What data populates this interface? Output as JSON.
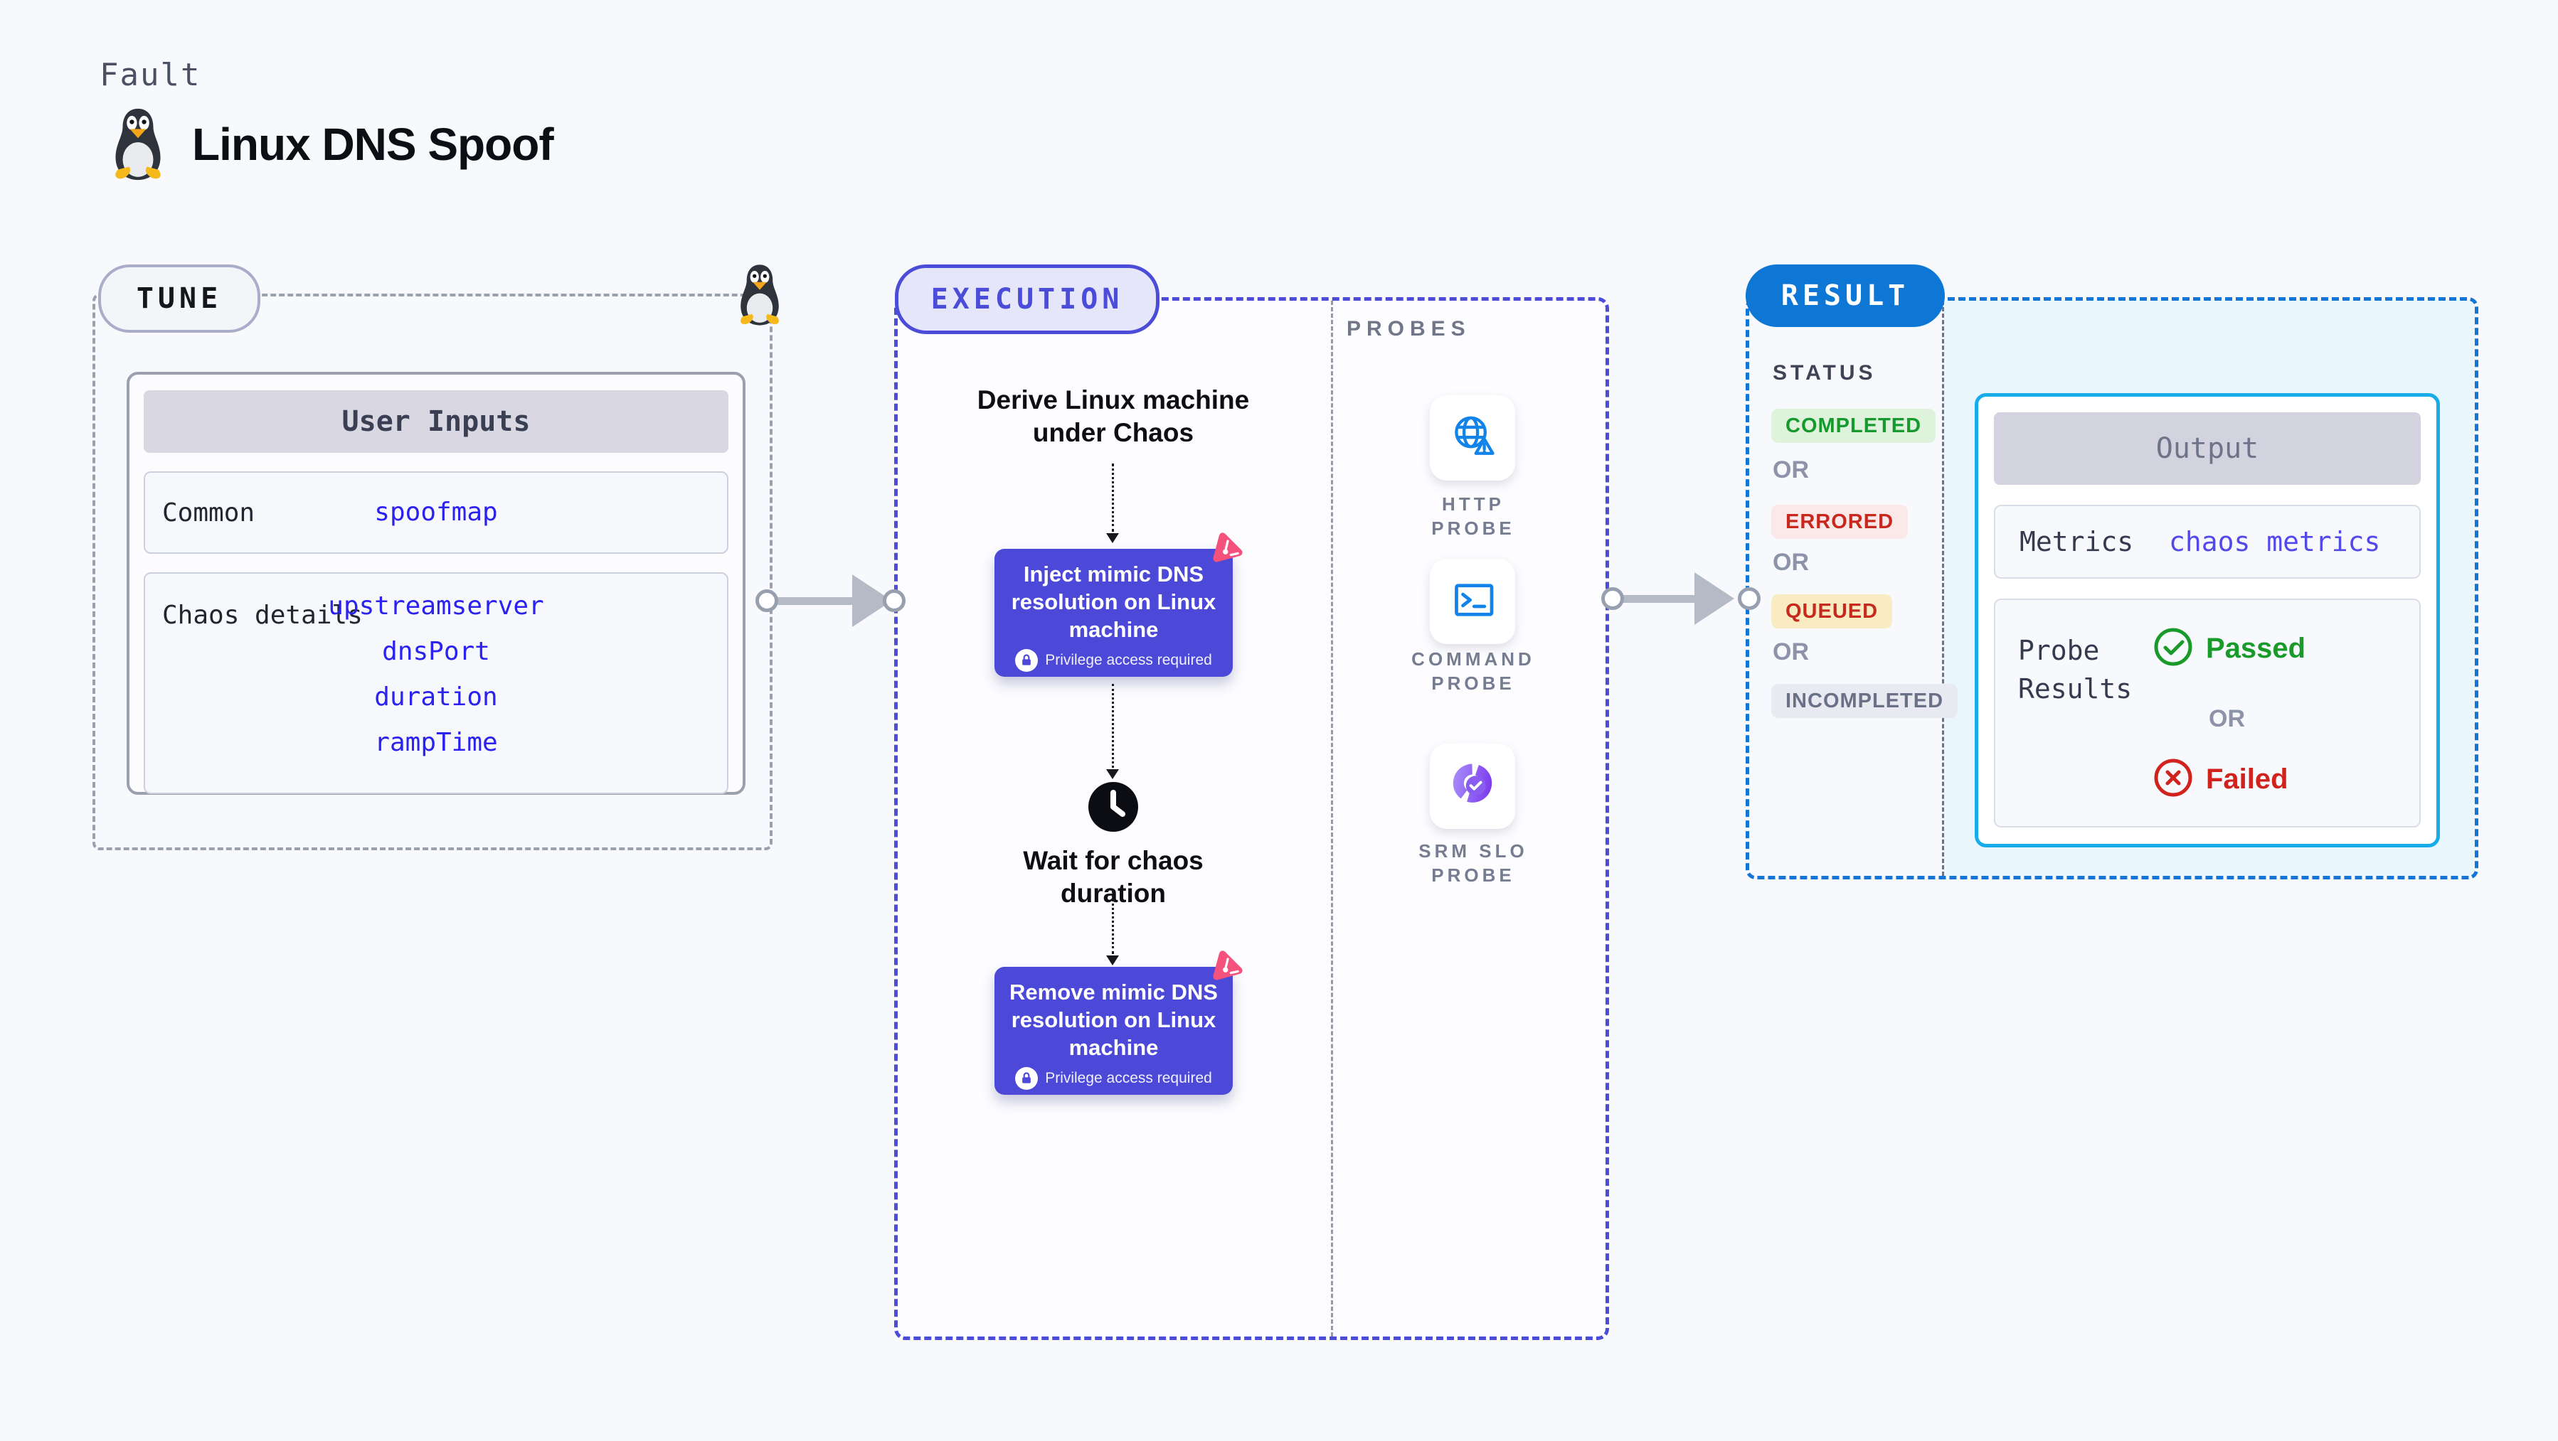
{
  "colors": {
    "page_bg": "#f7f9fc",
    "accent_indigo": "#4c48d8",
    "execution_border": "#4b4dd8",
    "execution_bg": "#e5e4f9",
    "result_blue": "#0e76d4",
    "result_bg": "#eaf6fe",
    "output_border": "#18abe9",
    "link_blue": "#2b22ef",
    "passed_green": "#1b9a2c",
    "failed_red": "#d0231d",
    "completed_bg": "#def2dc",
    "completed_fg": "#169a2e",
    "errored_bg": "#fbe8e8",
    "errored_fg": "#c8271e",
    "queued_bg": "#f9ecc2",
    "queued_fg": "#c52a1e",
    "incompleted_bg": "#e9eaf1",
    "incompleted_fg": "#6a7086",
    "probe_icon_blue": "#1283e8",
    "slo_purple": "#7c3aed",
    "litmus_pink": "#f4517c"
  },
  "header": {
    "eyebrow": "Fault",
    "title": "Linux DNS Spoof",
    "icon": "tux-penguin-icon"
  },
  "tune": {
    "badge": "TUNE",
    "corner_icon": "tux-penguin-icon",
    "card": {
      "title": "User Inputs",
      "rows": [
        {
          "label": "Common",
          "links": [
            "spoofmap"
          ]
        },
        {
          "label": "Chaos details",
          "links": [
            "upstreamserver",
            "dnsPort",
            "duration",
            "rampTime"
          ]
        }
      ]
    }
  },
  "execution": {
    "badge": "EXECUTION",
    "steps": {
      "derive": "Derive Linux machine under Chaos",
      "inject": {
        "title": "Inject mimic DNS resolution on Linux machine",
        "note": "Privilege access required"
      },
      "wait": "Wait for chaos duration",
      "remove": {
        "title": "Remove mimic DNS resolution on Linux machine",
        "note": "Privilege access required"
      }
    },
    "probes": {
      "title": "PROBES",
      "items": [
        {
          "label": "HTTP PROBE",
          "icon": "globe-alert-icon"
        },
        {
          "label": "COMMAND PROBE",
          "icon": "terminal-icon"
        },
        {
          "label": "SRM SLO PROBE",
          "icon": "slo-donut-check-icon"
        }
      ]
    }
  },
  "result": {
    "badge": "RESULT",
    "status": {
      "title": "STATUS",
      "separator": "OR",
      "items": [
        "COMPLETED",
        "ERRORED",
        "QUEUED",
        "INCOMPLETED"
      ]
    },
    "output": {
      "title": "Output",
      "metrics_label": "Metrics",
      "metrics_value": "chaos metrics",
      "probe_label": "Probe Results",
      "passed": "Passed",
      "or": "OR",
      "failed": "Failed"
    }
  }
}
